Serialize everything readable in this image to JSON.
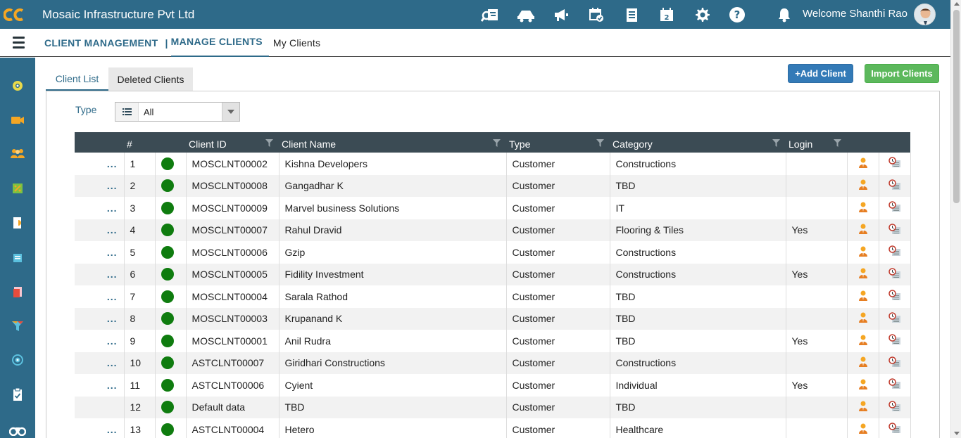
{
  "header": {
    "logo": "oc-logo",
    "company": "Mosaic Infrastructure Pvt Ltd",
    "welcome": "Welcome Shanthi Rao",
    "icons": [
      "search-report-icon",
      "delivery-truck-icon",
      "megaphone-icon",
      "calendar-check-icon",
      "ledger-icon",
      "calendar-2-icon",
      "gear-icon",
      "help-icon",
      "bell-icon"
    ]
  },
  "breadcrumb": {
    "level1": "CLIENT MANAGEMENT",
    "separator": "|",
    "level2": "MANAGE CLIENTS",
    "level3": "My Clients"
  },
  "sidebar": {
    "icons": [
      "dashboard-icon",
      "video-icon",
      "users-icon",
      "leaf-icon",
      "report-icon",
      "notes-icon",
      "book-icon",
      "funnel-icon",
      "target-icon",
      "clipboard-icon",
      "binoculars-icon"
    ]
  },
  "tabs": {
    "client_list": "Client List",
    "deleted_clients": "Deleted Clients"
  },
  "buttons": {
    "add_client": "+Add Client",
    "import_clients": "Import Clients"
  },
  "filter": {
    "type_label": "Type",
    "type_value": "All"
  },
  "table": {
    "columns": [
      "",
      "#",
      "",
      "Client ID",
      "Client Name",
      "Type",
      "Category",
      "Login",
      "",
      ""
    ],
    "rows": [
      {
        "menu": "...",
        "num": "1",
        "client_id": "MOSCLNT00002",
        "name": "Kishna Developers",
        "type": "Customer",
        "category": "Constructions",
        "login": ""
      },
      {
        "menu": "...",
        "num": "2",
        "client_id": "MOSCLNT00008",
        "name": "Gangadhar K",
        "type": "Customer",
        "category": "TBD",
        "login": ""
      },
      {
        "menu": "...",
        "num": "3",
        "client_id": "MOSCLNT00009",
        "name": "Marvel business Solutions",
        "type": "Customer",
        "category": "IT",
        "login": ""
      },
      {
        "menu": "...",
        "num": "4",
        "client_id": "MOSCLNT00007",
        "name": "Rahul Dravid",
        "type": "Customer",
        "category": "Flooring & Tiles",
        "login": "Yes"
      },
      {
        "menu": "...",
        "num": "5",
        "client_id": "MOSCLNT00006",
        "name": "Gzip",
        "type": "Customer",
        "category": "Constructions",
        "login": ""
      },
      {
        "menu": "...",
        "num": "6",
        "client_id": "MOSCLNT00005",
        "name": "Fidility Investment",
        "type": "Customer",
        "category": "Constructions",
        "login": "Yes"
      },
      {
        "menu": "...",
        "num": "7",
        "client_id": "MOSCLNT00004",
        "name": "Sarala Rathod",
        "type": "Customer",
        "category": "TBD",
        "login": ""
      },
      {
        "menu": "...",
        "num": "8",
        "client_id": "MOSCLNT00003",
        "name": "Krupanand K",
        "type": "Customer",
        "category": "TBD",
        "login": ""
      },
      {
        "menu": "...",
        "num": "9",
        "client_id": "MOSCLNT00001",
        "name": "Anil Rudra",
        "type": "Customer",
        "category": "TBD",
        "login": "Yes"
      },
      {
        "menu": "...",
        "num": "10",
        "client_id": "ASTCLNT00007",
        "name": "Giridhari Constructions",
        "type": "Customer",
        "category": "Constructions",
        "login": ""
      },
      {
        "menu": "...",
        "num": "11",
        "client_id": "ASTCLNT00006",
        "name": "Cyient",
        "type": "Customer",
        "category": "Individual",
        "login": "Yes"
      },
      {
        "menu": "",
        "num": "12",
        "client_id": "Default data",
        "name": "TBD",
        "type": "Customer",
        "category": "TBD",
        "login": ""
      },
      {
        "menu": "...",
        "num": "13",
        "client_id": "ASTCLNT00004",
        "name": "Hetero",
        "type": "Customer",
        "category": "Healthcare",
        "login": ""
      }
    ]
  },
  "colors": {
    "brand": "#2e6a89",
    "header_row": "#3b4b54",
    "status_active": "#0f7c0f",
    "add_button": "#337ab7",
    "import_button": "#5cb85c"
  }
}
